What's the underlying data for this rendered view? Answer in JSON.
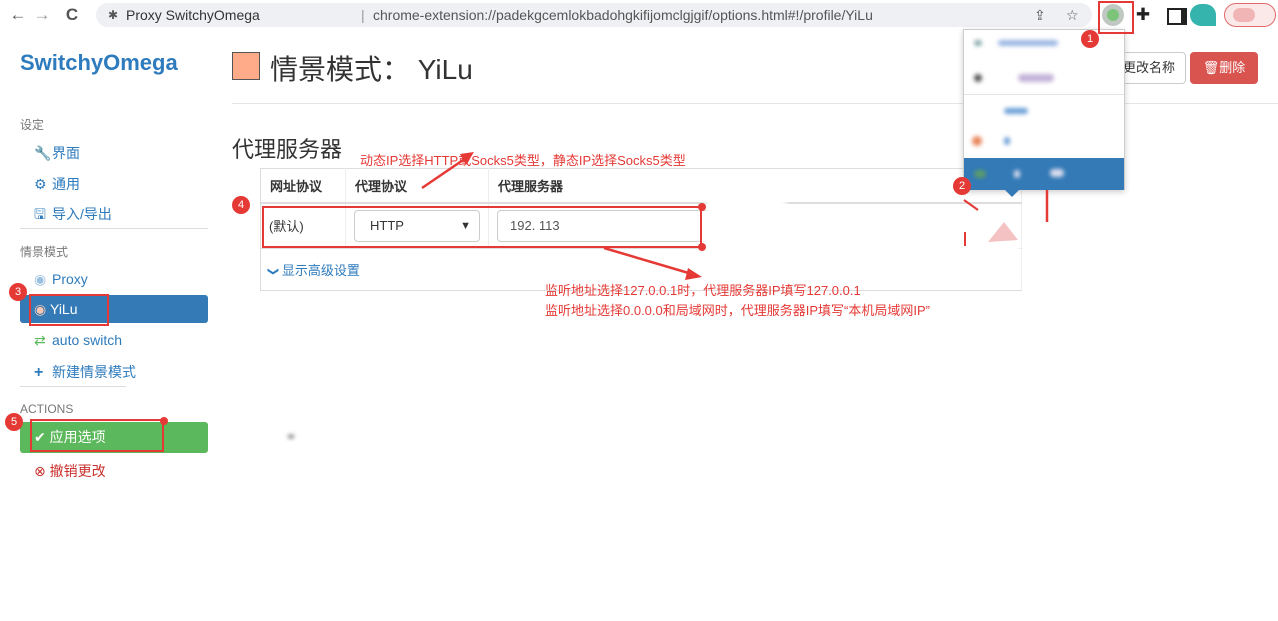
{
  "browser": {
    "tab_title": "Proxy SwitchyOmega",
    "separator": "|",
    "url": "chrome-extension://padekgcemlokbadohgkifijomclgjgif/options.html#!/profile/YiLu",
    "back_icon": "arrow-left",
    "forward_icon": "arrow-right",
    "reload_icon": "reload",
    "back_glyph": "←",
    "forward_glyph": "→",
    "reload_glyph": "C",
    "site_glyph": "✱",
    "share_glyph": "⇪",
    "star_glyph": "☆",
    "puzzle_glyph": "✚"
  },
  "sidebar": {
    "brand": "SwitchyOmega",
    "settings_header": "设定",
    "settings_items": [
      {
        "label": "界面",
        "icon": "wrench-icon",
        "glyph": "🔧"
      },
      {
        "label": "通用",
        "icon": "gear-icon",
        "glyph": "⚙"
      },
      {
        "label": "导入/导出",
        "icon": "floppy-icon",
        "glyph": "🖫"
      }
    ],
    "profiles_header": "情景模式",
    "profiles": [
      {
        "label": "Proxy",
        "icon": "globe-icon",
        "glyph": "◉"
      },
      {
        "label": "YiLu",
        "icon": "globe-icon",
        "glyph": "◉",
        "active": true
      },
      {
        "label": "auto switch",
        "icon": "switch-icon",
        "glyph": "⇄"
      },
      {
        "label": "新建情景模式",
        "icon": "plus-icon",
        "glyph": "+"
      }
    ],
    "actions_header": "ACTIONS",
    "apply_label": "应用选项",
    "apply_glyph": "✔",
    "discard_label": "撤销更改",
    "discard_glyph": "⊗"
  },
  "header": {
    "title": "情景模式：  YiLu",
    "rename_label": "更改名称",
    "delete_label": "删除",
    "delete_glyph": "🗑",
    "swatch_color": "#ffaa88"
  },
  "proxy_servers": {
    "section_title": "代理服务器",
    "columns": [
      "网址协议",
      "代理协议",
      "代理服务器"
    ],
    "rows": [
      {
        "scheme": "(默认)",
        "protocol": "HTTP",
        "server": "192.        113"
      }
    ],
    "advanced_label": "显示高级设置",
    "advanced_glyph": "❯"
  },
  "annotations": {
    "note_protocol": "动态IP选择HTTP或Socks5类型，静态IP选择Socks5类型",
    "note_listen_1": "监听地址选择127.0.0.1时，代理服务器IP填写127.0.0.1",
    "note_listen_2": "监听地址选择0.0.0.0和局域网时，代理服务器IP填写“本机局域网IP”",
    "badges": [
      "1",
      "2",
      "3",
      "4",
      "5"
    ]
  },
  "colors": {
    "brand_blue": "#2e7bbd",
    "active_blue": "#337ab7",
    "apply_green": "#5cb85c",
    "delete_red": "#d9534f",
    "annotation_red": "#e53935"
  }
}
